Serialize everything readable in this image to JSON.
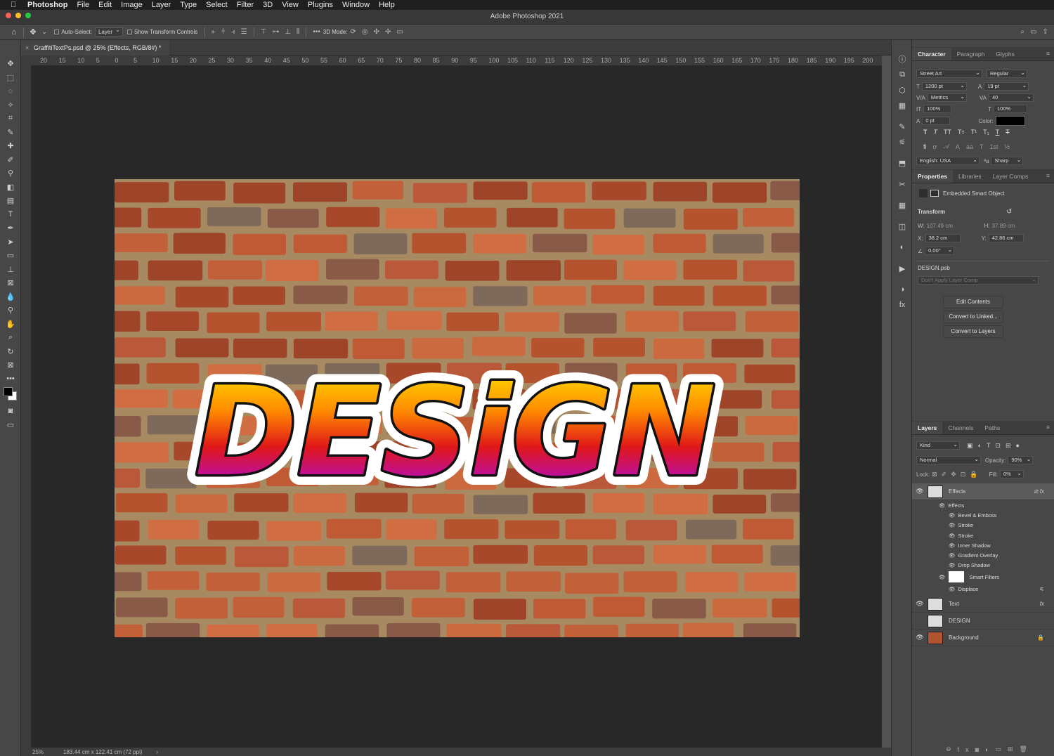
{
  "menubar": {
    "app": "Photoshop",
    "items": [
      "File",
      "Edit",
      "Image",
      "Layer",
      "Type",
      "Select",
      "Filter",
      "3D",
      "View",
      "Plugins",
      "Window",
      "Help"
    ]
  },
  "window": {
    "title": "Adobe Photoshop 2021"
  },
  "options": {
    "auto_select_label": "Auto-Select:",
    "auto_select_value": "Layer",
    "show_transform_label": "Show Transform Controls",
    "mode3d_label": "3D Mode:"
  },
  "document": {
    "tab_title": "GraffitiTextPs.psd @ 25% (Effects, RGB/8#) *",
    "zoom": "25%",
    "size_info": "183.44 cm x 122.41 cm (72 ppi)"
  },
  "ruler": {
    "top": [
      "20",
      "15",
      "10",
      "5",
      "0",
      "5",
      "10",
      "15",
      "20",
      "25",
      "30",
      "35",
      "40",
      "45",
      "50",
      "55",
      "60",
      "65",
      "70",
      "75",
      "80",
      "85",
      "90",
      "95",
      "100",
      "105",
      "110",
      "115",
      "120",
      "125",
      "130",
      "135",
      "140",
      "145",
      "150",
      "155",
      "160",
      "165",
      "170",
      "175",
      "180",
      "185",
      "190",
      "195",
      "200"
    ]
  },
  "canvas": {
    "graffiti_text": "DESiGN"
  },
  "character": {
    "tabs": [
      "Character",
      "Paragraph",
      "Glyphs"
    ],
    "font_family": "Street Art",
    "font_style": "Regular",
    "size": "1200 pt",
    "leading": "19 pt",
    "kerning": "Metrics",
    "tracking": "40",
    "vscale": "100%",
    "hscale": "100%",
    "baseline": "0 pt",
    "color_label": "Color:",
    "language": "English: USA",
    "aa_label": "ªa",
    "antialias": "Sharp"
  },
  "properties": {
    "tabs": [
      "Properties",
      "Libraries",
      "Layer Comps"
    ],
    "type": "Embedded Smart Object",
    "transform_label": "Transform",
    "w": "107.49 cm",
    "h": "37.89 cm",
    "x": "38.2 cm",
    "y": "42.86 cm",
    "angle": "0.00°",
    "file": "DESIGN.psb",
    "comp": "Don't Apply Layer Comp",
    "buttons": [
      "Edit Contents",
      "Convert to Linked...",
      "Convert to Layers"
    ]
  },
  "layers": {
    "tabs": [
      "Layers",
      "Channels",
      "Paths"
    ],
    "filter_kind": "Kind",
    "blend_mode": "Normal",
    "opacity_label": "Opacity:",
    "opacity": "90%",
    "lock_label": "Lock:",
    "fill_label": "Fill:",
    "fill": "0%",
    "items": [
      {
        "name": "Effects"
      },
      {
        "name": "Text"
      },
      {
        "name": "DESIGN"
      },
      {
        "name": "Background"
      }
    ],
    "effects_header": "Effects",
    "effects": [
      "Bevel & Emboss",
      "Stroke",
      "Stroke",
      "Inner Shadow",
      "Gradient Overlay",
      "Drop Shadow"
    ],
    "smart_filters": "Smart Filters",
    "displace": "Displace"
  }
}
